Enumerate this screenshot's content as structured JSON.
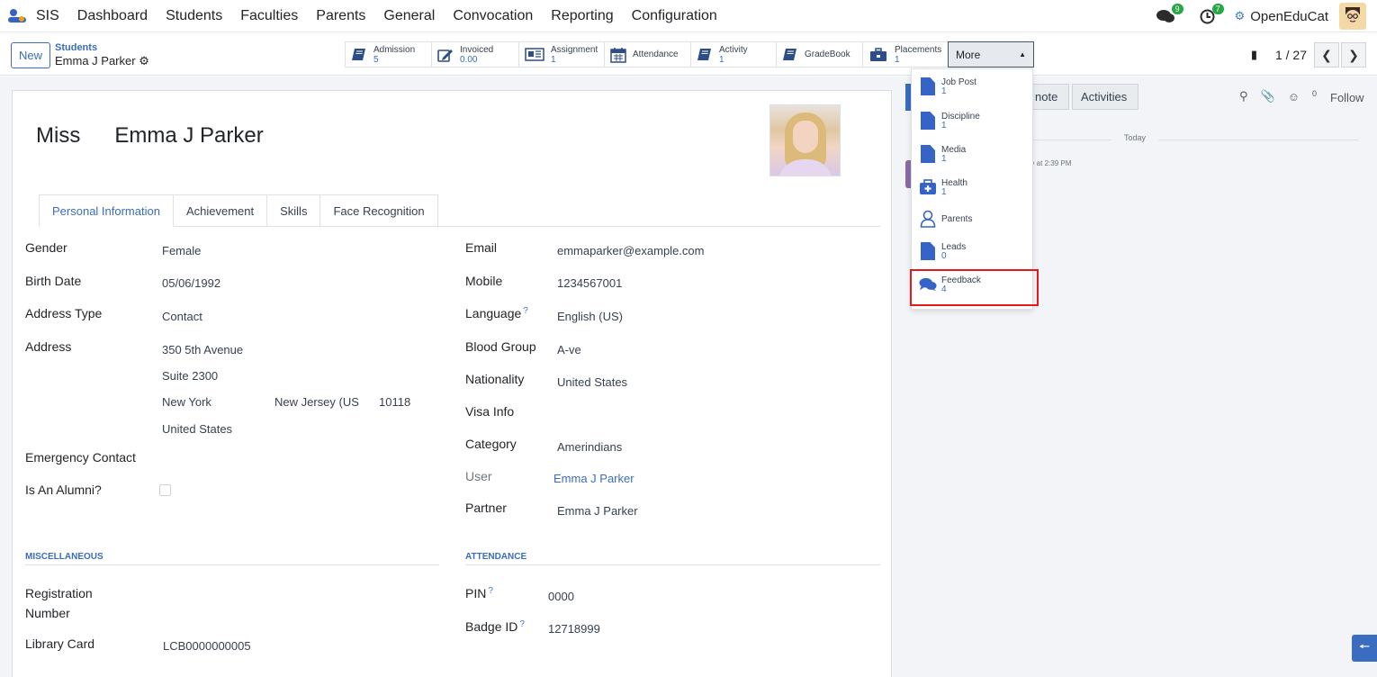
{
  "navbar": {
    "app_name": "SIS",
    "menu": [
      "Dashboard",
      "Students",
      "Faculties",
      "Parents",
      "General",
      "Convocation",
      "Reporting",
      "Configuration"
    ],
    "messages_badge": "9",
    "activities_badge": "7",
    "company": "OpenEduCat"
  },
  "control_panel": {
    "new_label": "New",
    "breadcrumb_parent": "Students",
    "breadcrumb_current": "Emma J Parker",
    "smart_buttons": [
      {
        "label": "Admission",
        "value": "5",
        "icon": "book-icon"
      },
      {
        "label": "Invoiced",
        "value": "0.00",
        "icon": "pencil-square-icon"
      },
      {
        "label": "Assignment",
        "value": "1",
        "icon": "newspaper-icon"
      },
      {
        "label": "Attendance",
        "value": "",
        "icon": "calendar-icon"
      },
      {
        "label": "Activity",
        "value": "1",
        "icon": "book-icon"
      },
      {
        "label": "GradeBook",
        "value": "",
        "icon": "book-icon"
      },
      {
        "label": "Placements",
        "value": "1",
        "icon": "briefcase-icon"
      }
    ],
    "more_label": "More",
    "pager": "1 / 27"
  },
  "more_menu": [
    {
      "label": "Job Post",
      "value": "1",
      "icon": "document-icon"
    },
    {
      "label": "Discipline",
      "value": "1",
      "icon": "document-icon"
    },
    {
      "label": "Media",
      "value": "1",
      "icon": "document-icon"
    },
    {
      "label": "Health",
      "value": "1",
      "icon": "medkit-icon"
    },
    {
      "label": "Parents",
      "value": "",
      "icon": "user-icon"
    },
    {
      "label": "Leads",
      "value": "0",
      "icon": "document-icon"
    },
    {
      "label": "Feedback",
      "value": "4",
      "icon": "comments-icon"
    }
  ],
  "student": {
    "title": "Miss",
    "name": "Emma J Parker"
  },
  "tabs": [
    "Personal Information",
    "Achievement",
    "Skills",
    "Face Recognition"
  ],
  "left_fields": {
    "gender_label": "Gender",
    "gender": "Female",
    "birth_label": "Birth Date",
    "birth": "05/06/1992",
    "address_type_label": "Address Type",
    "address_type": "Contact",
    "address_label": "Address",
    "street": "350 5th Avenue",
    "street2": "Suite 2300",
    "city": "New York",
    "state": "New Jersey (US",
    "zip": "10118",
    "country": "United States",
    "emergency_label": "Emergency Contact",
    "alumni_label": "Is An Alumni?"
  },
  "right_fields": {
    "email_label": "Email",
    "email": "emmaparker@example.com",
    "mobile_label": "Mobile",
    "mobile": "1234567001",
    "language_label": "Language",
    "language": "English (US)",
    "blood_label": "Blood Group",
    "blood": "A-ve",
    "nationality_label": "Nationality",
    "nationality": "United States",
    "visa_label": "Visa Info",
    "category_label": "Category",
    "category": "Amerindians",
    "user_label": "User",
    "user": "Emma J Parker",
    "partner_label": "Partner",
    "partner": "Emma J Parker"
  },
  "misc": {
    "title": "MISCELLANEOUS",
    "reg_label_1": "Registration",
    "reg_label_2": "Number",
    "library_label": "Library Card",
    "library": "LCB0000000005"
  },
  "attendance": {
    "title": "ATTENDANCE",
    "pin_label": "PIN",
    "pin": "0000",
    "badge_label": "Badge ID",
    "badge": "12718999"
  },
  "chatter": {
    "note_label": "note",
    "activities_label": "Activities",
    "followers_count": "0",
    "follow_label": "Follow",
    "today_label": "Today",
    "message_time": "ay at 2:39 PM"
  }
}
